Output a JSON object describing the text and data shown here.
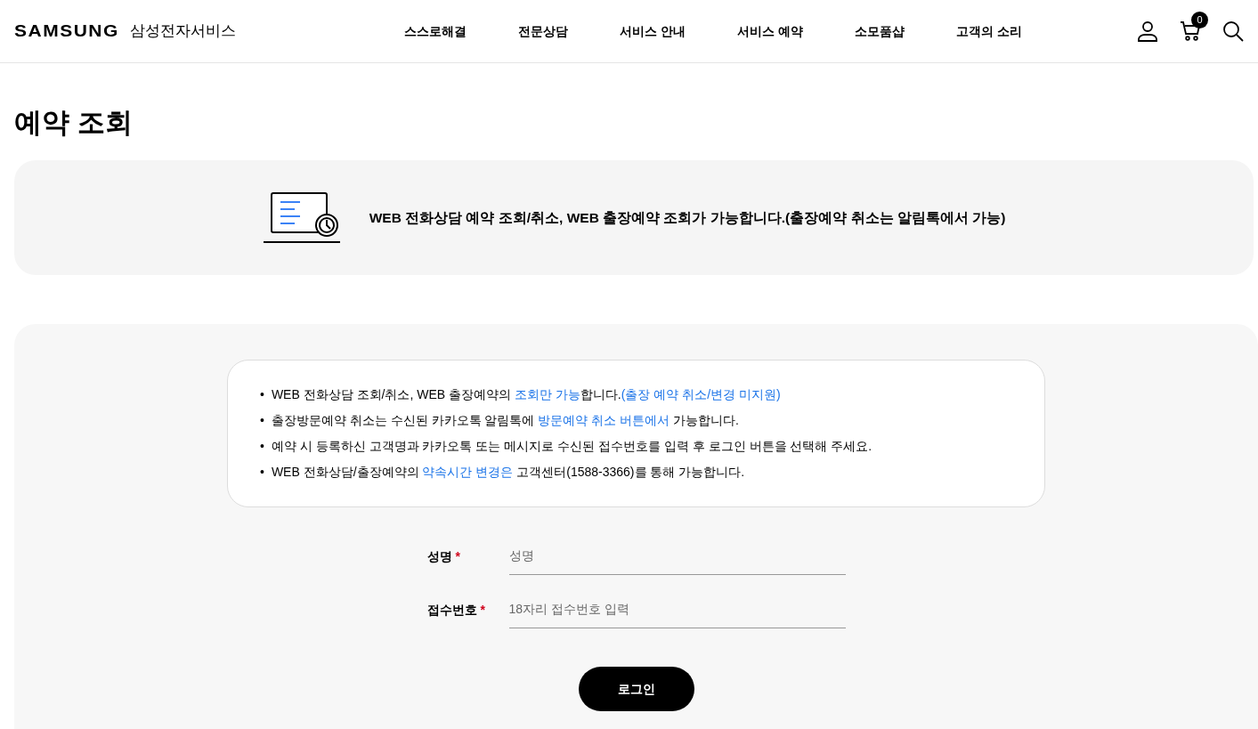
{
  "header": {
    "logo": "SAMSUNG",
    "site_name": "삼성전자서비스",
    "nav": [
      "스스로해결",
      "전문상담",
      "서비스 안내",
      "서비스 예약",
      "소모품샵",
      "고객의 소리"
    ],
    "cart_count": "0"
  },
  "page_title": "예약 조회",
  "banner": {
    "text": "WEB 전화상담 예약 조회/취소, WEB 출장예약 조회가 가능합니다.(출장예약 취소는 알림톡에서 가능)"
  },
  "notes": [
    {
      "bullet": "•",
      "segments": [
        {
          "text": "WEB 전화상담 조회/취소, WEB 출장예약의 ",
          "highlight": false
        },
        {
          "text": "조회만 가능",
          "highlight": true
        },
        {
          "text": "합니다.",
          "highlight": false
        },
        {
          "text": "(출장 예약 취소/변경 미지원)",
          "highlight": true
        }
      ]
    },
    {
      "bullet": "•",
      "segments": [
        {
          "text": "출장방문예약 취소는 수신된 카카오톡 알림톡에 ",
          "highlight": false
        },
        {
          "text": "방문예약 취소 버튼에서",
          "highlight": true
        },
        {
          "text": " 가능합니다.",
          "highlight": false
        }
      ]
    },
    {
      "bullet": "•",
      "segments": [
        {
          "text": "예약 시 등록하신 고객명과 카카오톡 또는 메시지로 수신된 접수번호를 입력 후 로그인 버튼을 선택해 주세요.",
          "highlight": false
        }
      ]
    },
    {
      "bullet": "•",
      "segments": [
        {
          "text": "WEB 전화상담/출장예약의 ",
          "highlight": false
        },
        {
          "text": "약속시간 변경은",
          "highlight": true
        },
        {
          "text": " 고객센터(1588-3366)를 통해 가능합니다.",
          "highlight": false
        }
      ]
    }
  ],
  "form": {
    "fields": [
      {
        "label": "성명",
        "required_mark": "*",
        "placeholder": "성명"
      },
      {
        "label": "접수번호",
        "required_mark": "*",
        "placeholder": "18자리 접수번호 입력"
      }
    ],
    "submit": "로그인"
  }
}
